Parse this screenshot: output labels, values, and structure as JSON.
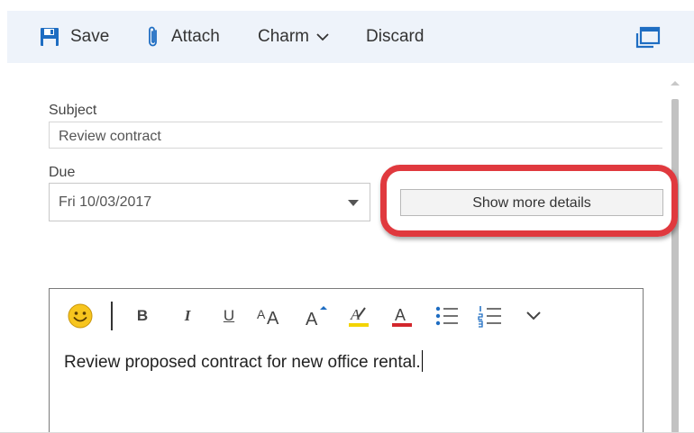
{
  "toolbar": {
    "save_label": "Save",
    "attach_label": "Attach",
    "charm_label": "Charm",
    "discard_label": "Discard",
    "icons": {
      "save": "save-icon",
      "attach": "paperclip-icon",
      "charm": "chevron-down-icon",
      "popout": "popout-icon"
    },
    "accent_color": "#1e6dc2"
  },
  "form": {
    "subject_label": "Subject",
    "subject_value": "Review contract",
    "due_label": "Due",
    "due_value": "Fri 10/03/2017",
    "more_details_label": "Show more details",
    "highlight_color": "#e0393e"
  },
  "editor": {
    "format_tools": [
      "emoji",
      "bold",
      "italic",
      "underline",
      "font-size",
      "grow-font",
      "highlight",
      "font-color",
      "bullets",
      "numbering",
      "more"
    ],
    "format_labels": {
      "bold": "B",
      "italic": "I",
      "underline": "U",
      "font_size": "AA",
      "grow_font": "A",
      "font_color": "A"
    },
    "body_text": "Review proposed contract for new office rental."
  }
}
